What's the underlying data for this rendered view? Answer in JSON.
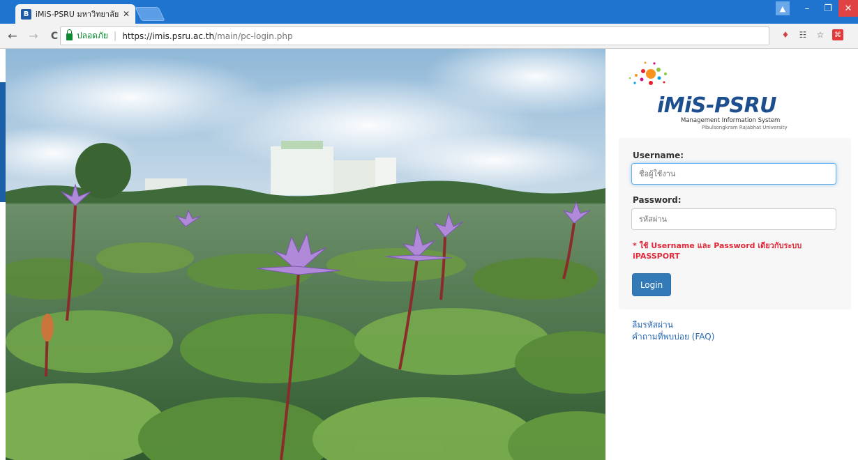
{
  "browser": {
    "tab": {
      "favicon": "B",
      "title": "iMiS-PSRU มหาวิทยาลัยราช",
      "close": "✕"
    },
    "window": {
      "user_icon": "user-icon",
      "minimize": "–",
      "restore": "❐",
      "close": "✕"
    },
    "nav": {
      "back": "←",
      "forward": "→",
      "reload": "C"
    },
    "address": {
      "secure_label": "ปลอดภัย",
      "url_host": "https://imis.psru.ac.th",
      "url_path": "/main/pc-login.php"
    },
    "extensions": [
      "shield-icon",
      "translate-icon",
      "star-icon",
      "pdf-icon"
    ]
  },
  "logo": {
    "title": "iMiS-PSRU",
    "subtitle": "Management Information System",
    "university": "Pibulsongkram Rajabhat University"
  },
  "login": {
    "username_label": "Username:",
    "username_placeholder": "ชื่อผู้ใช้งาน",
    "password_label": "Password:",
    "password_placeholder": "รหัสผ่าน",
    "note": "* ใช้ Username และ Password เดียวกับระบบ iPASSPORT",
    "button_label": "Login"
  },
  "links": {
    "forgot_password": "ลืมรหัสผ่าน",
    "faq": "คำถามที่พบบ่อย (FAQ)"
  },
  "colors": {
    "tabstrip": "#1f74d0",
    "brand_blue": "#1d4f8f",
    "button": "#337ab7",
    "note_red": "#e0293a",
    "link": "#2a6ab6"
  }
}
